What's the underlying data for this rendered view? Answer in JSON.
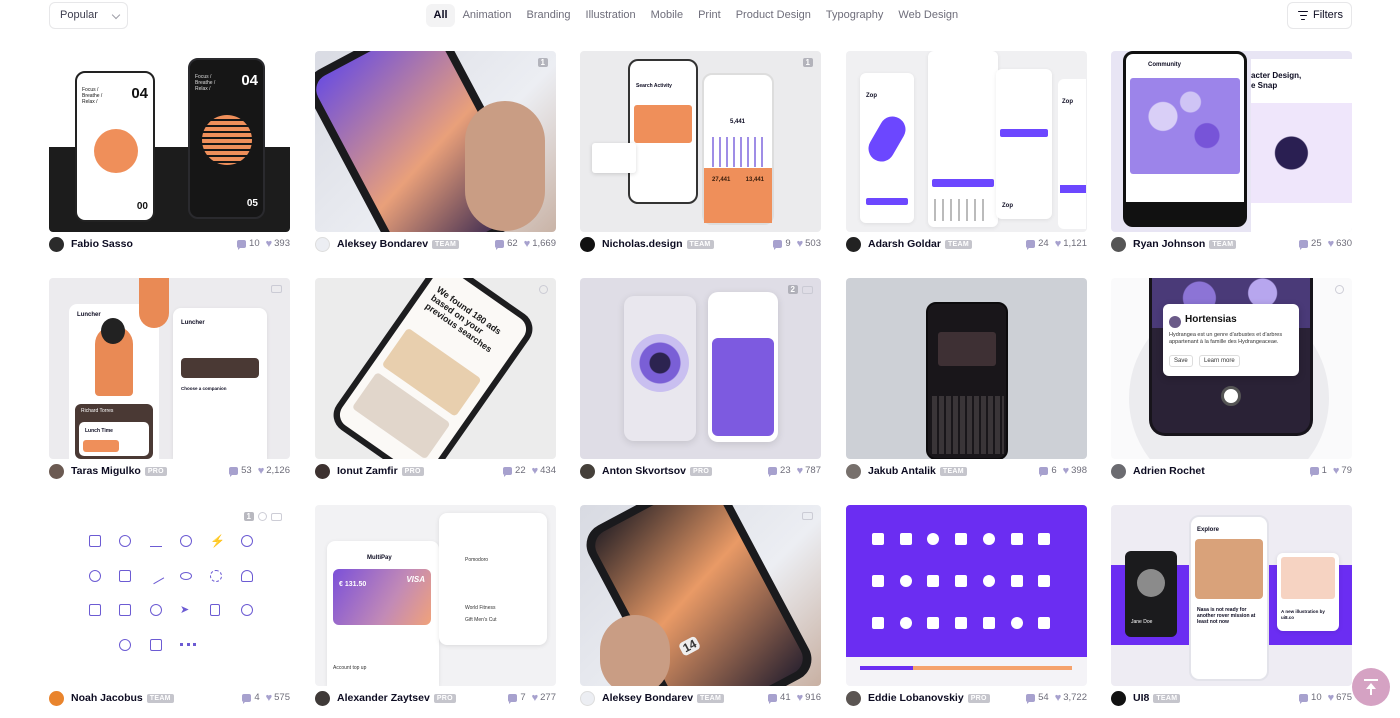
{
  "sort": {
    "label": "Popular"
  },
  "categories": [
    "All",
    "Animation",
    "Branding",
    "Illustration",
    "Mobile",
    "Print",
    "Product Design",
    "Typography",
    "Web Design"
  ],
  "active_category": "All",
  "filters": {
    "label": "Filters"
  },
  "colors": {
    "heart": "#a7a1ce",
    "accent_purple": "#6c47ff",
    "accent_orange": "#ef8f5a",
    "badge": "#c5c5cc"
  },
  "shots": [
    {
      "author": "Fabio Sasso",
      "badge": "",
      "comments": "10",
      "likes": "393",
      "texts": [
        "Focus / Breathe / Relax /",
        "04",
        "00",
        "Focus / Breathe / Relax /",
        "04",
        "05"
      ]
    },
    {
      "author": "Aleksey Bondarev",
      "badge": "TEAM",
      "comments": "62",
      "likes": "1,669",
      "overlay_count": "1"
    },
    {
      "author": "Nicholas.design",
      "badge": "TEAM",
      "comments": "9",
      "likes": "503",
      "texts": [
        "Search Activity",
        "5,441",
        "27,441",
        "13,441"
      ],
      "overlay_count": "1"
    },
    {
      "author": "Adarsh Goldar",
      "badge": "TEAM",
      "comments": "24",
      "likes": "1,121",
      "texts": [
        "Zop",
        "Zop",
        "Zop"
      ]
    },
    {
      "author": "Ryan Johnson",
      "badge": "TEAM",
      "comments": "25",
      "likes": "630",
      "texts": [
        "Community",
        "acter Design,",
        "e Snap"
      ]
    },
    {
      "author": "Taras Migulko",
      "badge": "PRO",
      "comments": "53",
      "likes": "2,126",
      "texts": [
        "Luncher",
        "Luncher",
        "Richard Torres",
        "Lunch Time",
        "Choose a companion"
      ]
    },
    {
      "author": "Ionut Zamfir",
      "badge": "PRO",
      "comments": "22",
      "likes": "434",
      "texts": [
        "We found 180 ads based on your previous searches"
      ]
    },
    {
      "author": "Anton Skvortsov",
      "badge": "PRO",
      "comments": "23",
      "likes": "787",
      "overlay_count": "2"
    },
    {
      "author": "Jakub Antalik",
      "badge": "TEAM",
      "comments": "6",
      "likes": "398"
    },
    {
      "author": "Adrien Rochet",
      "badge": "",
      "comments": "1",
      "likes": "79",
      "texts": [
        "Hortensias",
        "Hydrangea est un genre d'arbustes et d'arbres appartenant à la famille des Hydrangeaceae.",
        "Save",
        "Learn more"
      ]
    },
    {
      "author": "Noah Jacobus",
      "badge": "TEAM",
      "comments": "4",
      "likes": "575",
      "overlay_count": "1"
    },
    {
      "author": "Alexander Zaytsev",
      "badge": "PRO",
      "comments": "7",
      "likes": "277",
      "texts": [
        "MultiPay",
        "VISA",
        "€ 131.50",
        "Account top up",
        "Pomodoro",
        "World Fitness",
        "Gift Men's Cut"
      ]
    },
    {
      "author": "Aleksey Bondarev",
      "badge": "TEAM",
      "comments": "41",
      "likes": "916",
      "texts": [
        "14"
      ]
    },
    {
      "author": "Eddie Lobanovskiy",
      "badge": "PRO",
      "comments": "54",
      "likes": "3,722"
    },
    {
      "author": "UI8",
      "badge": "TEAM",
      "comments": "10",
      "likes": "675",
      "texts": [
        "Explore",
        "Jane Doe",
        "Nasa is not ready for another rover mission at least not now",
        "A new illustration by ui8.co"
      ]
    }
  ]
}
